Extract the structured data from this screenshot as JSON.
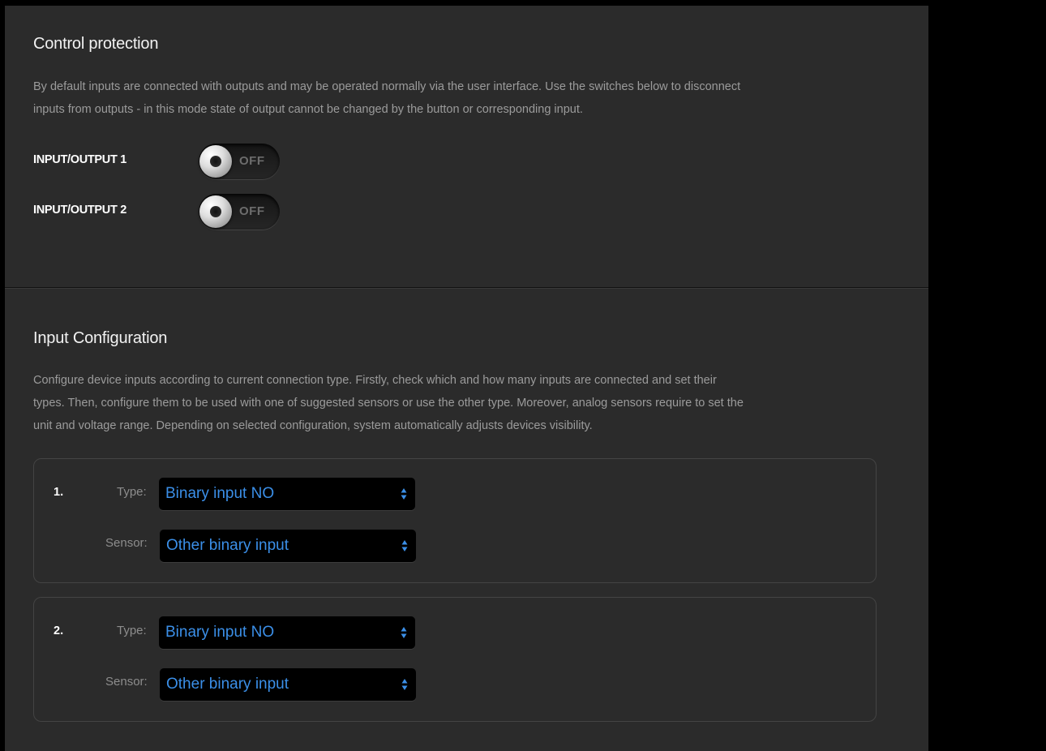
{
  "control_protection": {
    "title": "Control protection",
    "description_line1": "By default inputs are connected with outputs and may be operated normally via the user interface. Use the switches below to disconnect",
    "description_line2": "inputs from outputs - in this mode state of output cannot be changed by the button or corresponding input.",
    "rows": [
      {
        "label": "INPUT/OUTPUT 1",
        "state": "OFF"
      },
      {
        "label": "INPUT/OUTPUT 2",
        "state": "OFF"
      }
    ]
  },
  "input_configuration": {
    "title": "Input Configuration",
    "description_line1": "Configure device inputs according to current connection type. Firstly, check which and how many inputs are connected and set their",
    "description_line2": "types. Then, configure them to be used with one of suggested sensors or use the other type. Moreover, analog sensors require to set the",
    "description_line3": "unit and voltage range. Depending on selected configuration, system automatically adjusts devices visibility.",
    "inputs": [
      {
        "number": "1.",
        "type_label": "Type:",
        "type_value": "Binary input NO",
        "sensor_label": "Sensor:",
        "sensor_value": "Other binary input"
      },
      {
        "number": "2.",
        "type_label": "Type:",
        "type_value": "Binary input NO",
        "sensor_label": "Sensor:",
        "sensor_value": "Other binary input"
      }
    ]
  },
  "colors": {
    "panel_background": "#2b2b2b",
    "outer_background": "#000000",
    "select_text": "#3b8fe8",
    "description_text": "#9b9b9b"
  },
  "icons": {
    "toggle_knob": "toggle-knob-icon",
    "select_arrows": "updown-arrows-icon"
  }
}
